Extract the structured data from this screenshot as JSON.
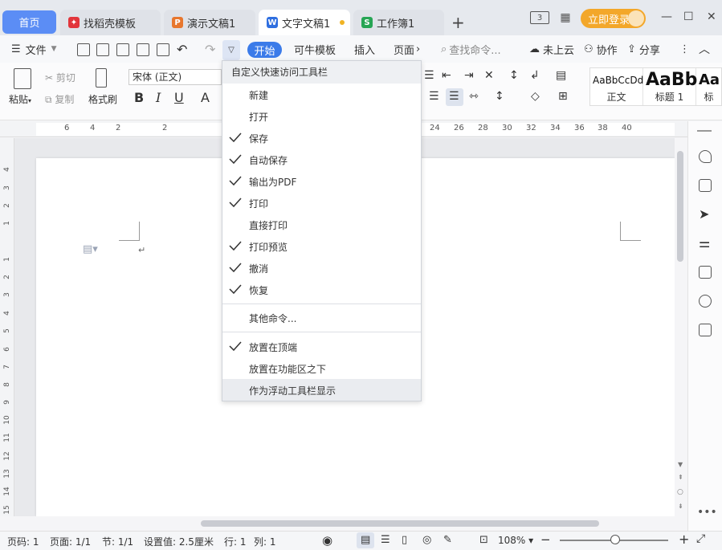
{
  "tabs": {
    "home": "首页",
    "items": [
      {
        "label": "找稻壳模板",
        "logo_color": "#e2353b"
      },
      {
        "label": "演示文稿1",
        "logo_color": "#e8772e"
      },
      {
        "label": "文字文稿1",
        "logo_color": "#2f6fe0"
      },
      {
        "label": "工作簿1",
        "logo_color": "#27a554"
      }
    ],
    "badge": "3"
  },
  "login_label": "立即登录",
  "menubar": {
    "file": "文件",
    "start": "开始",
    "template": "可牛模板",
    "insert": "插入",
    "page": "页面",
    "search_placeholder": "查找命令...",
    "cloud": "未上云",
    "collab": "协作",
    "share": "分享"
  },
  "ribbon": {
    "paste": "粘贴",
    "cut": "剪切",
    "copy": "复制",
    "format_painter": "格式刷",
    "font_name": "宋体 (正文)",
    "styles": [
      {
        "sample": "AaBbCcDd",
        "name": "正文"
      },
      {
        "sample": "AaBb",
        "name": "标题 1"
      },
      {
        "sample": "Aa",
        "name": "标"
      }
    ]
  },
  "ruler_h": [
    "6",
    "4",
    "2",
    "2",
    "24",
    "26",
    "28",
    "30",
    "32",
    "34",
    "36",
    "38",
    "40"
  ],
  "ruler_v": [
    "4",
    "3",
    "2",
    "1",
    "1",
    "2",
    "3",
    "4",
    "5",
    "6",
    "7",
    "8",
    "9",
    "10",
    "11",
    "12",
    "13",
    "14",
    "15"
  ],
  "dropdown": {
    "title": "自定义快速访问工具栏",
    "items": [
      {
        "label": "新建",
        "checked": false
      },
      {
        "label": "打开",
        "checked": false
      },
      {
        "label": "保存",
        "checked": true
      },
      {
        "label": "自动保存",
        "checked": true
      },
      {
        "label": "输出为PDF",
        "checked": true
      },
      {
        "label": "打印",
        "checked": true
      },
      {
        "label": "直接打印",
        "checked": false
      },
      {
        "label": "打印预览",
        "checked": true
      },
      {
        "label": "撤消",
        "checked": true
      },
      {
        "label": "恢复",
        "checked": true
      }
    ],
    "other": "其他命令...",
    "positions": [
      {
        "label": "放置在顶端",
        "checked": true
      },
      {
        "label": "放置在功能区之下",
        "checked": false
      },
      {
        "label": "作为浮动工具栏显示",
        "checked": false
      }
    ]
  },
  "statusbar": {
    "page_num": "页码: 1",
    "pages": "页面: 1/1",
    "section": "节: 1/1",
    "setting": "设置值: 2.5厘米",
    "row": "行: 1",
    "col": "列: 1",
    "zoom": "108%"
  },
  "colors": {
    "accent": "#3b7be9",
    "home_tab": "#5b8df5",
    "login": "#f3a72a"
  }
}
